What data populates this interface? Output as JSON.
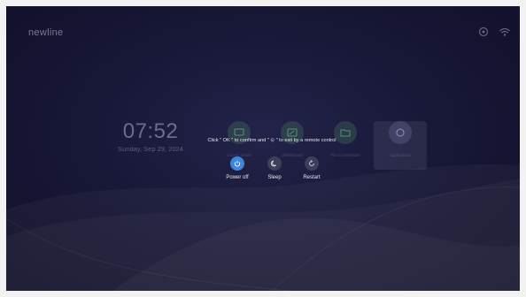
{
  "brand": {
    "logo": "newline"
  },
  "clock": {
    "time": "07:52",
    "date": "Sunday, Sep 29, 2024"
  },
  "apps": [
    {
      "label": "Screen Share",
      "icon": "screen-share-icon"
    },
    {
      "label": "Whiteboard",
      "icon": "whiteboard-icon"
    },
    {
      "label": "File Commander",
      "icon": "file-commander-icon"
    },
    {
      "label": "Applications",
      "icon": "applications-icon"
    }
  ],
  "power_dialog": {
    "prompt": "Click \" OK \" to confirm and \" ⊙ \" to exit by a remote control",
    "options": [
      {
        "label": "Power off",
        "icon": "power-icon",
        "selected": true
      },
      {
        "label": "Sleep",
        "icon": "moon-icon",
        "selected": false
      },
      {
        "label": "Restart",
        "icon": "restart-icon",
        "selected": false
      }
    ]
  },
  "status_icons": [
    "settings-icon",
    "wifi-icon"
  ],
  "colors": {
    "accent": "#3f84dd",
    "background": "#181838"
  }
}
